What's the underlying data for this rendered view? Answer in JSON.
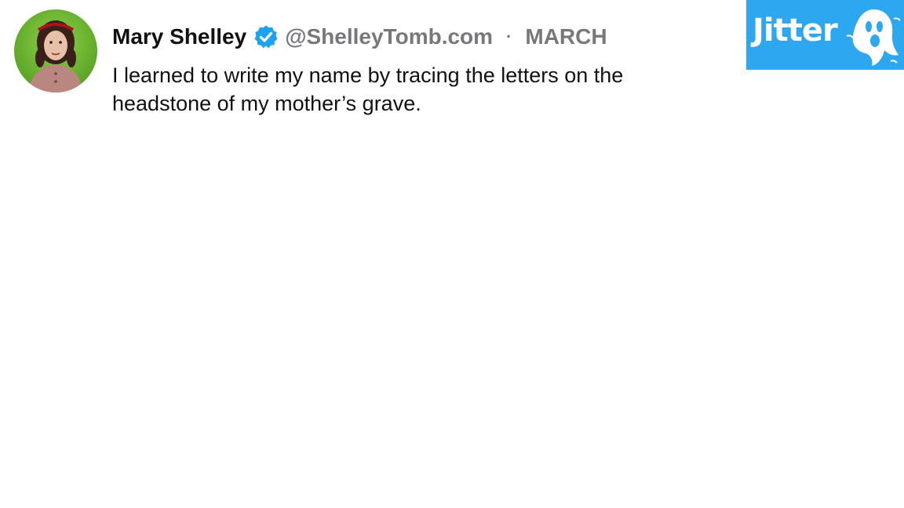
{
  "post": {
    "author_name": "Mary Shelley",
    "verified_icon": "verified-check-icon",
    "handle": "@ShelleyTomb.com",
    "separator": "·",
    "date": "MARCH",
    "text": "I learned to write my name by tracing the letters on the headstone of my mother’s grave."
  },
  "avatar": {
    "icon": "profile-photo"
  },
  "brand": {
    "logo_text": "Jitter",
    "logo_icon": "ghost-icon",
    "background_color": "#2da7f0"
  },
  "colors": {
    "name": "#111111",
    "muted": "#77787b",
    "verified": "#1da1f2"
  }
}
